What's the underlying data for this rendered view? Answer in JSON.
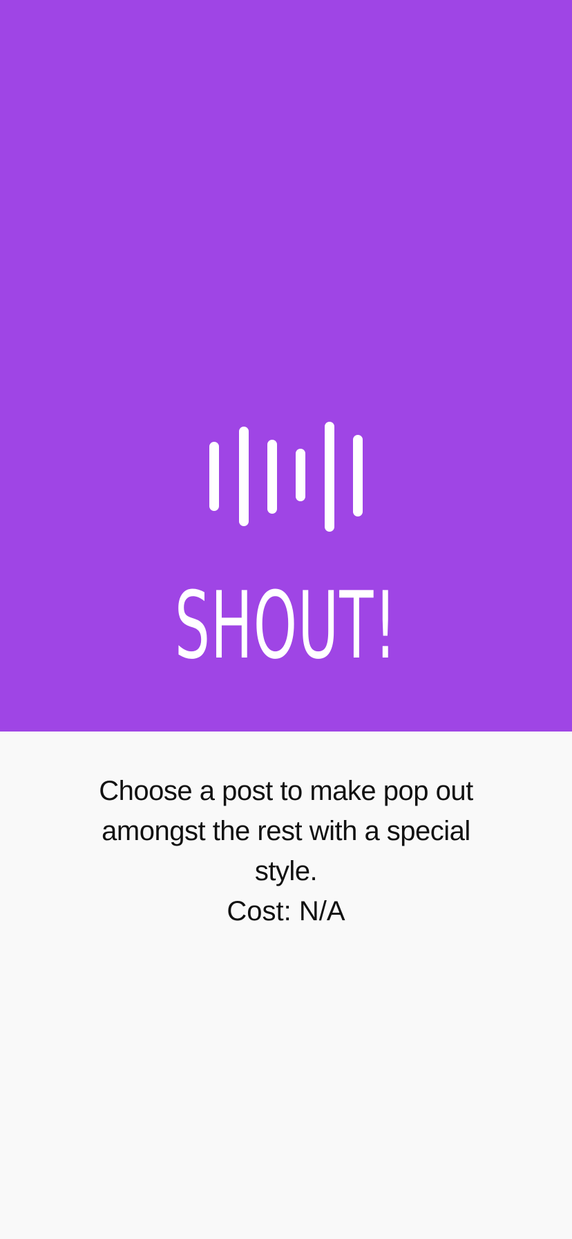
{
  "colors": {
    "hero_background": "#9f45e5",
    "page_background": "#f9f9f9",
    "logo_foreground": "#ffffff",
    "text": "#111111"
  },
  "hero": {
    "logo_icon": "sound-wave-icon",
    "title": "SHOUT!"
  },
  "info": {
    "description": "Choose a post to make pop out amongst the rest with a special style.",
    "cost": "Cost: N/A"
  }
}
